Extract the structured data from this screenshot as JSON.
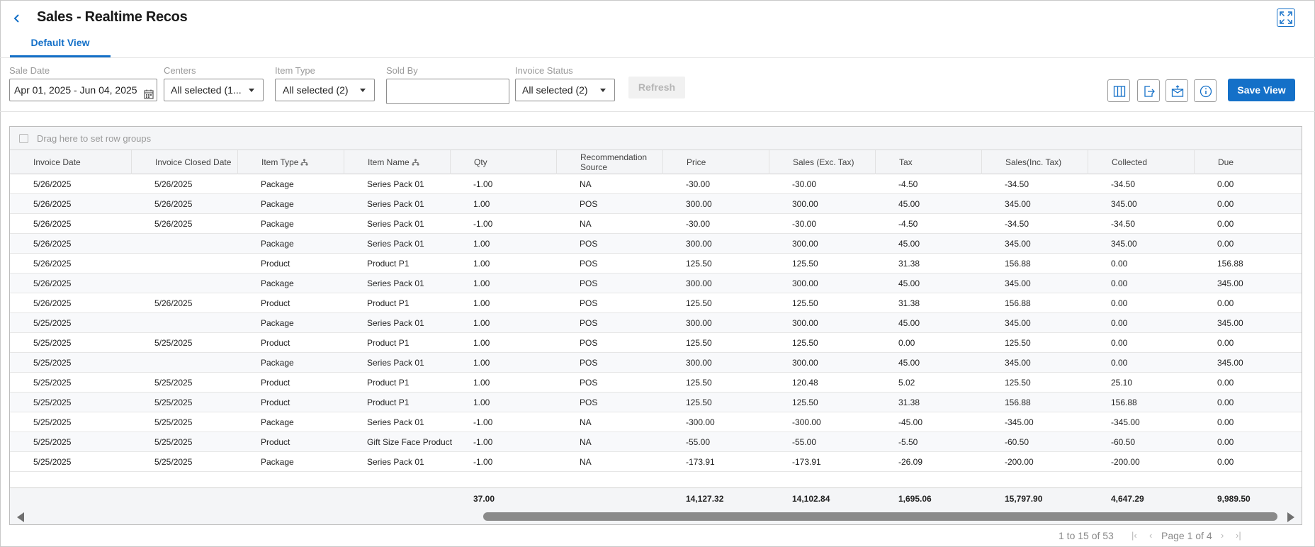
{
  "header": {
    "title": "Sales - Realtime Recos",
    "back_icon": "chevron-left-icon",
    "expand_icon": "expand-icon"
  },
  "tabs": [
    {
      "label": "Default View",
      "active": true
    }
  ],
  "filters": {
    "sale_date": {
      "label": "Sale Date",
      "value": "Apr 01, 2025 - Jun 04, 2025"
    },
    "centers": {
      "label": "Centers",
      "value": "All selected (1..."
    },
    "item_type": {
      "label": "Item Type",
      "value": "All selected (2)"
    },
    "sold_by": {
      "label": "Sold By",
      "value": ""
    },
    "invoice_status": {
      "label": "Invoice Status",
      "value": "All selected (2)"
    },
    "refresh_label": "Refresh"
  },
  "toolbar": {
    "save_label": "Save View",
    "icons": [
      "columns-icon",
      "export-icon",
      "email-icon",
      "info-icon"
    ]
  },
  "grid": {
    "group_placeholder": "Drag here to set row groups",
    "columns": [
      "Invoice Date",
      "Invoice Closed Date",
      "Item Type",
      "Item Name",
      "Qty",
      "Recommendation Source",
      "Price",
      "Sales (Exc. Tax)",
      "Tax",
      "Sales(Inc. Tax)",
      "Collected",
      "Due"
    ],
    "rows": [
      [
        "5/26/2025",
        "5/26/2025",
        "Package",
        "Series Pack 01",
        "-1.00",
        "NA",
        "-30.00",
        "-30.00",
        "-4.50",
        "-34.50",
        "-34.50",
        "0.00"
      ],
      [
        "5/26/2025",
        "5/26/2025",
        "Package",
        "Series Pack 01",
        "1.00",
        "POS",
        "300.00",
        "300.00",
        "45.00",
        "345.00",
        "345.00",
        "0.00"
      ],
      [
        "5/26/2025",
        "5/26/2025",
        "Package",
        "Series Pack 01",
        "-1.00",
        "NA",
        "-30.00",
        "-30.00",
        "-4.50",
        "-34.50",
        "-34.50",
        "0.00"
      ],
      [
        "5/26/2025",
        "",
        "Package",
        "Series Pack 01",
        "1.00",
        "POS",
        "300.00",
        "300.00",
        "45.00",
        "345.00",
        "345.00",
        "0.00"
      ],
      [
        "5/26/2025",
        "",
        "Product",
        "Product P1",
        "1.00",
        "POS",
        "125.50",
        "125.50",
        "31.38",
        "156.88",
        "0.00",
        "156.88"
      ],
      [
        "5/26/2025",
        "",
        "Package",
        "Series Pack 01",
        "1.00",
        "POS",
        "300.00",
        "300.00",
        "45.00",
        "345.00",
        "0.00",
        "345.00"
      ],
      [
        "5/26/2025",
        "5/26/2025",
        "Product",
        "Product P1",
        "1.00",
        "POS",
        "125.50",
        "125.50",
        "31.38",
        "156.88",
        "0.00",
        "0.00"
      ],
      [
        "5/25/2025",
        "",
        "Package",
        "Series Pack 01",
        "1.00",
        "POS",
        "300.00",
        "300.00",
        "45.00",
        "345.00",
        "0.00",
        "345.00"
      ],
      [
        "5/25/2025",
        "5/25/2025",
        "Product",
        "Product P1",
        "1.00",
        "POS",
        "125.50",
        "125.50",
        "0.00",
        "125.50",
        "0.00",
        "0.00"
      ],
      [
        "5/25/2025",
        "",
        "Package",
        "Series Pack 01",
        "1.00",
        "POS",
        "300.00",
        "300.00",
        "45.00",
        "345.00",
        "0.00",
        "345.00"
      ],
      [
        "5/25/2025",
        "5/25/2025",
        "Product",
        "Product P1",
        "1.00",
        "POS",
        "125.50",
        "120.48",
        "5.02",
        "125.50",
        "25.10",
        "0.00"
      ],
      [
        "5/25/2025",
        "5/25/2025",
        "Product",
        "Product P1",
        "1.00",
        "POS",
        "125.50",
        "125.50",
        "31.38",
        "156.88",
        "156.88",
        "0.00"
      ],
      [
        "5/25/2025",
        "5/25/2025",
        "Package",
        "Series Pack 01",
        "-1.00",
        "NA",
        "-300.00",
        "-300.00",
        "-45.00",
        "-345.00",
        "-345.00",
        "0.00"
      ],
      [
        "5/25/2025",
        "5/25/2025",
        "Product",
        "Gift Size Face Product",
        "-1.00",
        "NA",
        "-55.00",
        "-55.00",
        "-5.50",
        "-60.50",
        "-60.50",
        "0.00"
      ],
      [
        "5/25/2025",
        "5/25/2025",
        "Package",
        "Series Pack 01",
        "-1.00",
        "NA",
        "-173.91",
        "-173.91",
        "-26.09",
        "-200.00",
        "-200.00",
        "0.00"
      ]
    ],
    "totals": [
      "",
      "",
      "",
      "",
      "37.00",
      "",
      "14,127.32",
      "14,102.84",
      "1,695.06",
      "15,797.90",
      "4,647.29",
      "9,989.50"
    ]
  },
  "pagination": {
    "summary": "1 to 15 of 53",
    "page_label": "Page 1 of 4"
  },
  "colors": {
    "accent": "#1470c8"
  }
}
